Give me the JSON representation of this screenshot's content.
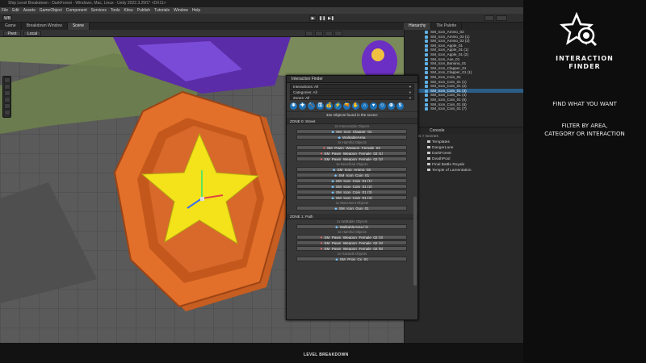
{
  "window_title": "Ship Level Breakdown - DarkForest - Windows, Mac, Linux - Unity 2022.3.25f1* <DX11>",
  "menu": [
    "File",
    "Edit",
    "Assets",
    "GameObject",
    "Component",
    "Services",
    "Tools",
    "Kitsu",
    "Publish",
    "Tutorials",
    "Window",
    "Help"
  ],
  "toolbar": {
    "account": "WB",
    "play": "▶",
    "pause": "❚❚",
    "step": "▶❚"
  },
  "scene_tabs": [
    "Game",
    "Breakdown Window",
    "Scene"
  ],
  "scene_toolbar": {
    "pivot": "Pivot",
    "space": "Local"
  },
  "hierarchy_tabs": [
    "Hierarchy",
    "Tile Palette"
  ],
  "hierarchy_items": [
    "SM_Icon_Ammo_02",
    "SM_Icon_Ammo_02 (1)",
    "SM_Icon_Ammo_02 (2)",
    "SM_Icon_Apple_01",
    "SM_Icon_Apple_01 (1)",
    "SM_Icon_Apple_01 (2)",
    "SM_Icon_Axe_01",
    "SM_Icon_Banana_01",
    "SM_Icon_Clapper_01",
    "SM_Icon_Clapper_01 (1)",
    "SM_Icon_Coin_01",
    "SM_Icon_Coin_01 (1)",
    "SM_Icon_Coin_01 (2)",
    "SM_Icon_Coin_01 (3)",
    "SM_Icon_Coin_01 (4)",
    "SM_Icon_Coin_01 (5)",
    "SM_Icon_Coin_01 (6)",
    "SM_Icon_Coin_01 (7)"
  ],
  "hierarchy_selected_index": 13,
  "console_tab": "Console",
  "project": {
    "breadcrumb": "Assets > Scenes",
    "items": [
      "Templates",
      "DangerLane",
      "DarkForest",
      "DeathPool",
      "Final Battle Royale",
      "Temple of Lamentation"
    ]
  },
  "finder": {
    "title": "Interaction Finder",
    "interactions": "Interactions: All",
    "categories": "Categories: All",
    "zones": "Zones: All",
    "icons": [
      "❄",
      "✚",
      "🔨",
      "⚿",
      "💰",
      "⚡",
      "🔫",
      "✋",
      "⌂",
      "♥",
      "☺",
      "⊕",
      "S"
    ],
    "count_text": "34x Objects found in the scene:",
    "zones_list": [
      {
        "name": "ZONE 0: Street",
        "groups": [
          {
            "label": "2x Interactable Objects",
            "items": [
              {
                "glyph": "b",
                "text": "SM_Icon_Clapper_01"
              },
              {
                "glyph": "b",
                "text": "WalkableArea"
              }
            ]
          },
          {
            "label": "3x Harmful Objects",
            "items": [
              {
                "glyph": "i",
                "text": "SM_Pawn_Weapon_Female_02"
              },
              {
                "glyph": "i",
                "text": "SM_Pawn_Weapon_Female_02 (1)"
              },
              {
                "glyph": "i",
                "text": "SM_Pawn_Weapon_Female_02 (2)"
              }
            ]
          },
          {
            "label": "6x Beneficial Objects",
            "items": [
              {
                "glyph": "b",
                "text": "SM_Icon_Ammo_02"
              },
              {
                "glyph": "b",
                "text": "SM_Icon_Coin_01"
              },
              {
                "glyph": "b",
                "text": "SM_Icon_Coin_01 (1)"
              },
              {
                "glyph": "b",
                "text": "SM_Icon_Coin_01 (2)"
              },
              {
                "glyph": "b",
                "text": "SM_Icon_Coin_01 (3)"
              },
              {
                "glyph": "b",
                "text": "SM_Icon_Coin_01 (4)"
              }
            ]
          },
          {
            "label": "1x Movement Objects",
            "items": [
              {
                "glyph": "b",
                "text": "SM_Icon_Gun_01"
              }
            ]
          }
        ]
      },
      {
        "name": "ZONE 1: Path",
        "groups": [
          {
            "label": "1x Walkable Objects",
            "items": [
              {
                "glyph": "b",
                "text": "WalkableArea (1)"
              }
            ]
          },
          {
            "label": "3x Harmful Objects",
            "items": [
              {
                "glyph": "i",
                "text": "SM_Pawn_Weapon_Female_02 (3)"
              },
              {
                "glyph": "i",
                "text": "SM_Pawn_Weapon_Female_02 (4)"
              },
              {
                "glyph": "i",
                "text": "SM_Pawn_Weapon_Female_02 (5)"
              }
            ]
          },
          {
            "label": "1x Hazards Objects",
            "items": [
              {
                "glyph": "b",
                "text": "SM_Prop_Cx_01"
              }
            ]
          }
        ]
      }
    ]
  },
  "bottom_logo": "LEVEL BREAKDOWN",
  "promo": {
    "title_line1": "INTERACTION",
    "title_line2": "FINDER",
    "text1": "FIND WHAT YOU WANT",
    "text2_line1": "FILTER BY AREA,",
    "text2_line2": "CATEGORY OR INTERACTION"
  },
  "colors": {
    "accent_blue": "#1b72b8",
    "coin_orange": "#e2702a",
    "star_yellow": "#f4e21a",
    "selection": "#2c5d87"
  }
}
